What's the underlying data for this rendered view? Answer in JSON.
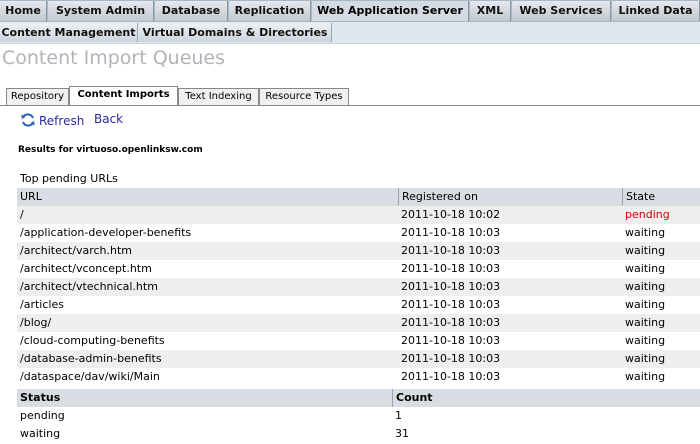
{
  "nav": {
    "tabs": [
      {
        "label": "Home"
      },
      {
        "label": "System Admin"
      },
      {
        "label": "Database"
      },
      {
        "label": "Replication"
      },
      {
        "label": "Web Application Server"
      },
      {
        "label": "XML"
      },
      {
        "label": "Web Services"
      },
      {
        "label": "Linked Data"
      }
    ],
    "subtabs": [
      {
        "label": "Content Management"
      },
      {
        "label": "Virtual Domains & Directories"
      }
    ]
  },
  "page_title": "Content Import Queues",
  "inner_tabs": [
    {
      "label": "Repository"
    },
    {
      "label": "Content Imports"
    },
    {
      "label": "Text Indexing"
    },
    {
      "label": "Resource Types"
    }
  ],
  "toolbar": {
    "refresh_label": "Refresh",
    "back_label": "Back"
  },
  "results_text": "Results for virtuoso.openlinksw.com",
  "pending_section": {
    "caption": "Top pending URLs",
    "headers": {
      "url": "URL",
      "registered": "Registered on",
      "state": "State"
    },
    "rows": [
      {
        "url": "/",
        "registered": "2011-10-18 10:02",
        "state": "pending"
      },
      {
        "url": "/application-developer-benefits",
        "registered": "2011-10-18 10:03",
        "state": "waiting"
      },
      {
        "url": "/architect/varch.htm",
        "registered": "2011-10-18 10:03",
        "state": "waiting"
      },
      {
        "url": "/architect/vconcept.htm",
        "registered": "2011-10-18 10:03",
        "state": "waiting"
      },
      {
        "url": "/architect/vtechnical.htm",
        "registered": "2011-10-18 10:03",
        "state": "waiting"
      },
      {
        "url": "/articles",
        "registered": "2011-10-18 10:03",
        "state": "waiting"
      },
      {
        "url": "/blog/",
        "registered": "2011-10-18 10:03",
        "state": "waiting"
      },
      {
        "url": "/cloud-computing-benefits",
        "registered": "2011-10-18 10:03",
        "state": "waiting"
      },
      {
        "url": "/database-admin-benefits",
        "registered": "2011-10-18 10:03",
        "state": "waiting"
      },
      {
        "url": "/dataspace/dav/wiki/Main",
        "registered": "2011-10-18 10:03",
        "state": "waiting"
      }
    ]
  },
  "status_section": {
    "headers": {
      "status": "Status",
      "count": "Count"
    },
    "rows": [
      {
        "status": "pending",
        "count": "1"
      },
      {
        "status": "waiting",
        "count": "31"
      }
    ]
  },
  "colors": {
    "pending_state": "#d40000",
    "link": "#2c2c9c",
    "title": "#b0b4b8"
  }
}
